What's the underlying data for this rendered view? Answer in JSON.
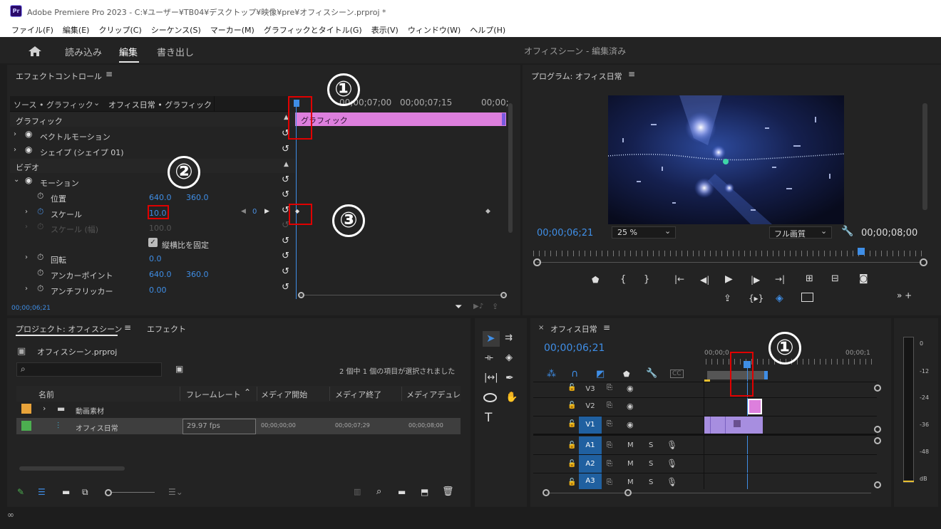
{
  "window": {
    "title": "Adobe Premiere Pro 2023 - C:¥ユーザー¥TB04¥デスクトップ¥映像¥pre¥オフィスシーン.prproj *",
    "logo": "Pr"
  },
  "menu": [
    "ファイル(F)",
    "編集(E)",
    "クリップ(C)",
    "シーケンス(S)",
    "マーカー(M)",
    "グラフィックとタイトル(G)",
    "表示(V)",
    "ウィンドウ(W)",
    "ヘルプ(H)"
  ],
  "workspace": {
    "tabs": [
      "読み込み",
      "編集",
      "書き出し"
    ],
    "active": "編集",
    "project_status": "オフィスシーン - 編集済み"
  },
  "effect_controls": {
    "title": "エフェクトコントロール",
    "source": "ソース • グラフィック",
    "clip": "オフィス日常 • グラフィック",
    "ruler": [
      "00;00;07;00",
      "00;00;07;15",
      "00;00;"
    ],
    "clip_bar": "グラフィック",
    "sections": {
      "graphic": "グラフィック",
      "video": "ビデオ"
    },
    "rows": {
      "vector": "ベクトルモーション",
      "shape": "シェイプ (シェイプ 01)",
      "motion": "モーション",
      "position": {
        "label": "位置",
        "x": "640.0",
        "y": "360.0"
      },
      "scale": {
        "label": "スケール",
        "value": "10.0",
        "kf": "0"
      },
      "scale_w": {
        "label": "スケール (幅)",
        "value": "100.0"
      },
      "uniform": "縦横比を固定",
      "rotation": {
        "label": "回転",
        "value": "0.0"
      },
      "anchor": {
        "label": "アンカーポイント",
        "x": "640.0",
        "y": "360.0"
      },
      "flicker": {
        "label": "アンチフリッカー",
        "value": "0.00"
      }
    },
    "timecode": "00;00;06;21"
  },
  "program": {
    "title": "プログラム: オフィス日常",
    "timecode": "00;00;06;21",
    "zoom": "25 %",
    "quality": "フル画質",
    "duration": "00;00;08;00"
  },
  "project": {
    "tabs": [
      "プロジェクト: オフィスシーン",
      "エフェクト"
    ],
    "file": "オフィスシーン.prproj",
    "selection": "2 個中 1 個の項目が選択されました",
    "columns": [
      "名前",
      "フレームレート",
      "メディア開始",
      "メディア終了",
      "メディアデュレー"
    ],
    "rows": [
      {
        "name": "動画素材",
        "color": "#e8a33a",
        "type": "folder",
        "fps": "",
        "start": "",
        "end": "",
        "dur": ""
      },
      {
        "name": "オフィス日常",
        "color": "#4caf50",
        "type": "sequence",
        "fps": "29.97 fps",
        "start": "00;00;00;00",
        "end": "00;00;07;29",
        "dur": "00;00;08;00"
      }
    ]
  },
  "timeline": {
    "title": "オフィス日常",
    "timecode": "00;00;06;21",
    "ruler": [
      "00;00;0",
      "00;00;1"
    ],
    "video_tracks": [
      "V3",
      "V2",
      "V1"
    ],
    "audio_tracks": [
      "A1",
      "A2",
      "A3"
    ],
    "meter": [
      "0",
      "-12",
      "-24",
      "-36",
      "-48",
      "dB"
    ]
  },
  "annotations": [
    "①",
    "②",
    "③",
    "①"
  ]
}
